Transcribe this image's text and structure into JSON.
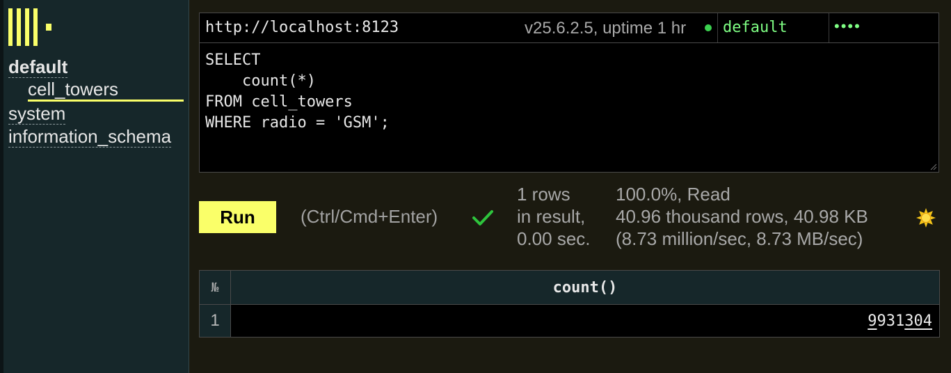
{
  "sidebar": {
    "databases": [
      {
        "name": "default",
        "selected": true,
        "tables": [
          "cell_towers"
        ]
      },
      {
        "name": "system",
        "selected": false,
        "tables": []
      },
      {
        "name": "information_schema",
        "selected": false,
        "tables": []
      }
    ]
  },
  "connection": {
    "url": "http://localhost:8123",
    "version_info": "v25.6.2.5, uptime 1 hr",
    "status_color": "#3bd14f",
    "user": "default",
    "password_mask": "••••"
  },
  "editor": {
    "query": "SELECT\n    count(*)\nFROM cell_towers\nWHERE radio = 'GSM';"
  },
  "run": {
    "button_label": "Run",
    "hint": "(Ctrl/Cmd+Enter)",
    "status_icon": "check-icon"
  },
  "stats": {
    "rows_line1": "1 rows",
    "rows_line2": "in result,",
    "rows_line3": "0.00 sec.",
    "read_line1": "100.0%, Read",
    "read_line2": "40.96 thousand rows, 40.98 KB",
    "read_line3": "(8.73 million/sec, 8.73 MB/sec)"
  },
  "theme_icon": "sun-icon",
  "result": {
    "num_header": "№",
    "columns": [
      "count()"
    ],
    "rows": [
      {
        "num": "1",
        "value_parts": [
          "9",
          "931",
          "304"
        ]
      }
    ]
  },
  "colors": {
    "accent": "#faff69",
    "sidebar_bg": "#16272a",
    "user_text": "#7fff84",
    "check": "#2ec43d"
  }
}
